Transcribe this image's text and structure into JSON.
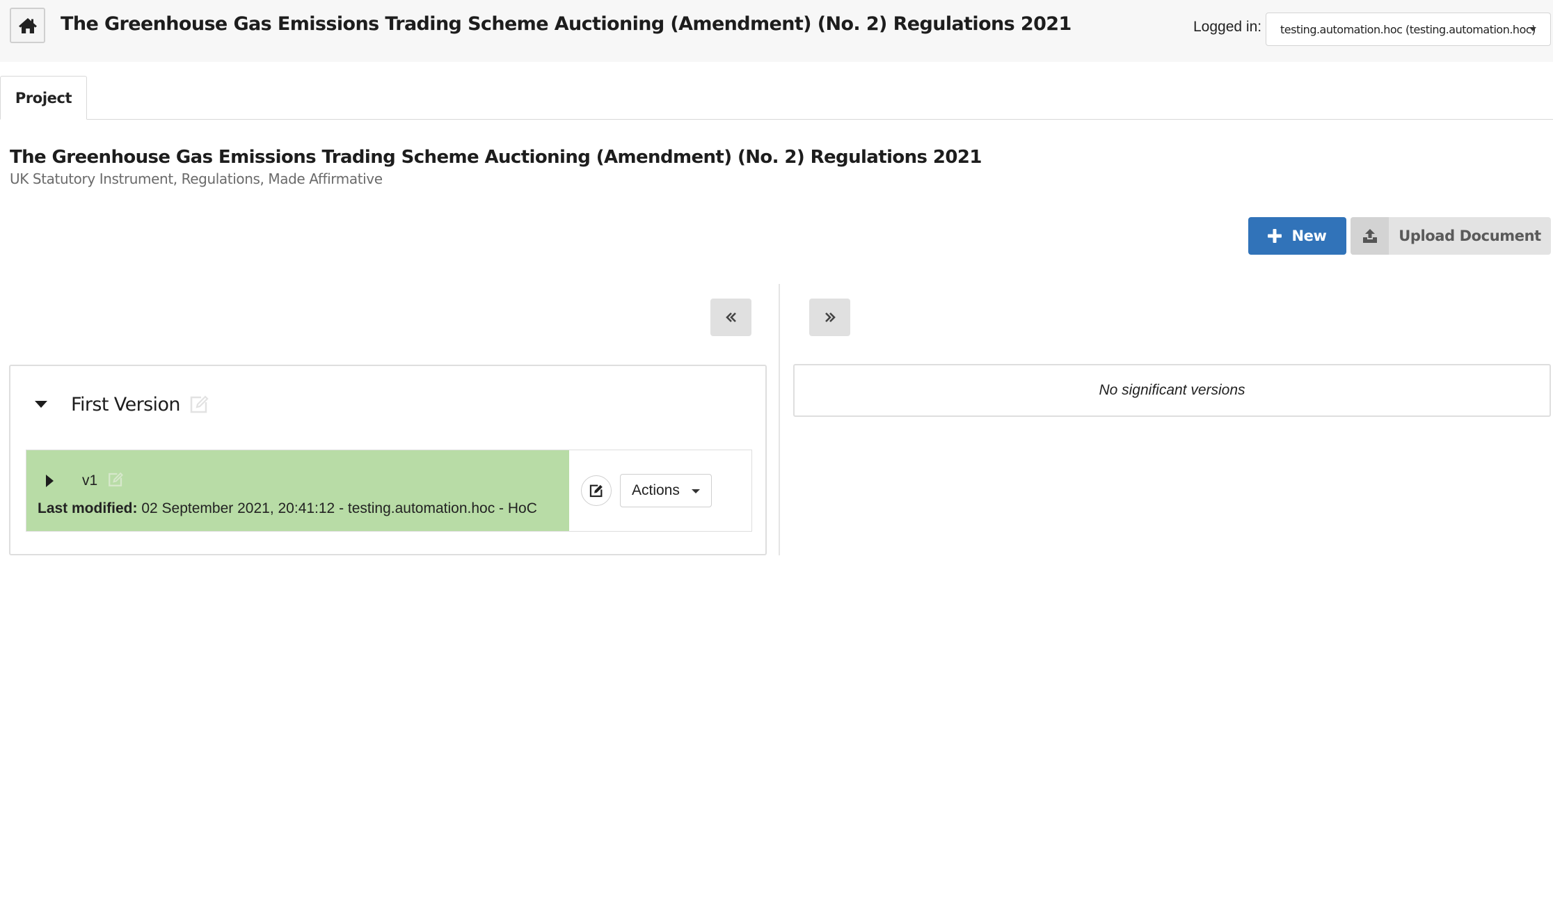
{
  "header": {
    "title": "The Greenhouse Gas Emissions Trading Scheme Auctioning (Amendment) (No. 2) Regulations 2021",
    "logged_in_label": "Logged in:",
    "user_selected": "testing.automation.hoc (testing.automation.hoc)"
  },
  "tabs": [
    {
      "label": "Project",
      "active": true
    }
  ],
  "project": {
    "title": "The Greenhouse Gas Emissions Trading Scheme Auctioning (Amendment) (No. 2) Regulations 2021",
    "subtitle": "UK Statutory Instrument, Regulations, Made Affirmative"
  },
  "toolbar": {
    "new_label": "New",
    "upload_label": "Upload Document"
  },
  "left_panel": {
    "group_title": "First Version",
    "versions": [
      {
        "label": "v1",
        "modified_label": "Last modified:",
        "modified_value": "02 September 2021, 20:41:12 - testing.automation.hoc - HoC",
        "status_color": "#b8dca6",
        "actions_label": "Actions"
      }
    ]
  },
  "right_panel": {
    "empty_message": "No significant versions"
  },
  "colors": {
    "primary": "#3173b9",
    "version_highlight": "#b8dca6",
    "topbar_bg": "#f7f7f7"
  },
  "icons": {
    "home": "home-icon",
    "new": "plus-icon",
    "upload": "upload-icon",
    "collapse_left": "double-chevron-left-icon",
    "expand_right": "double-chevron-right-icon",
    "edit": "edit-icon"
  }
}
